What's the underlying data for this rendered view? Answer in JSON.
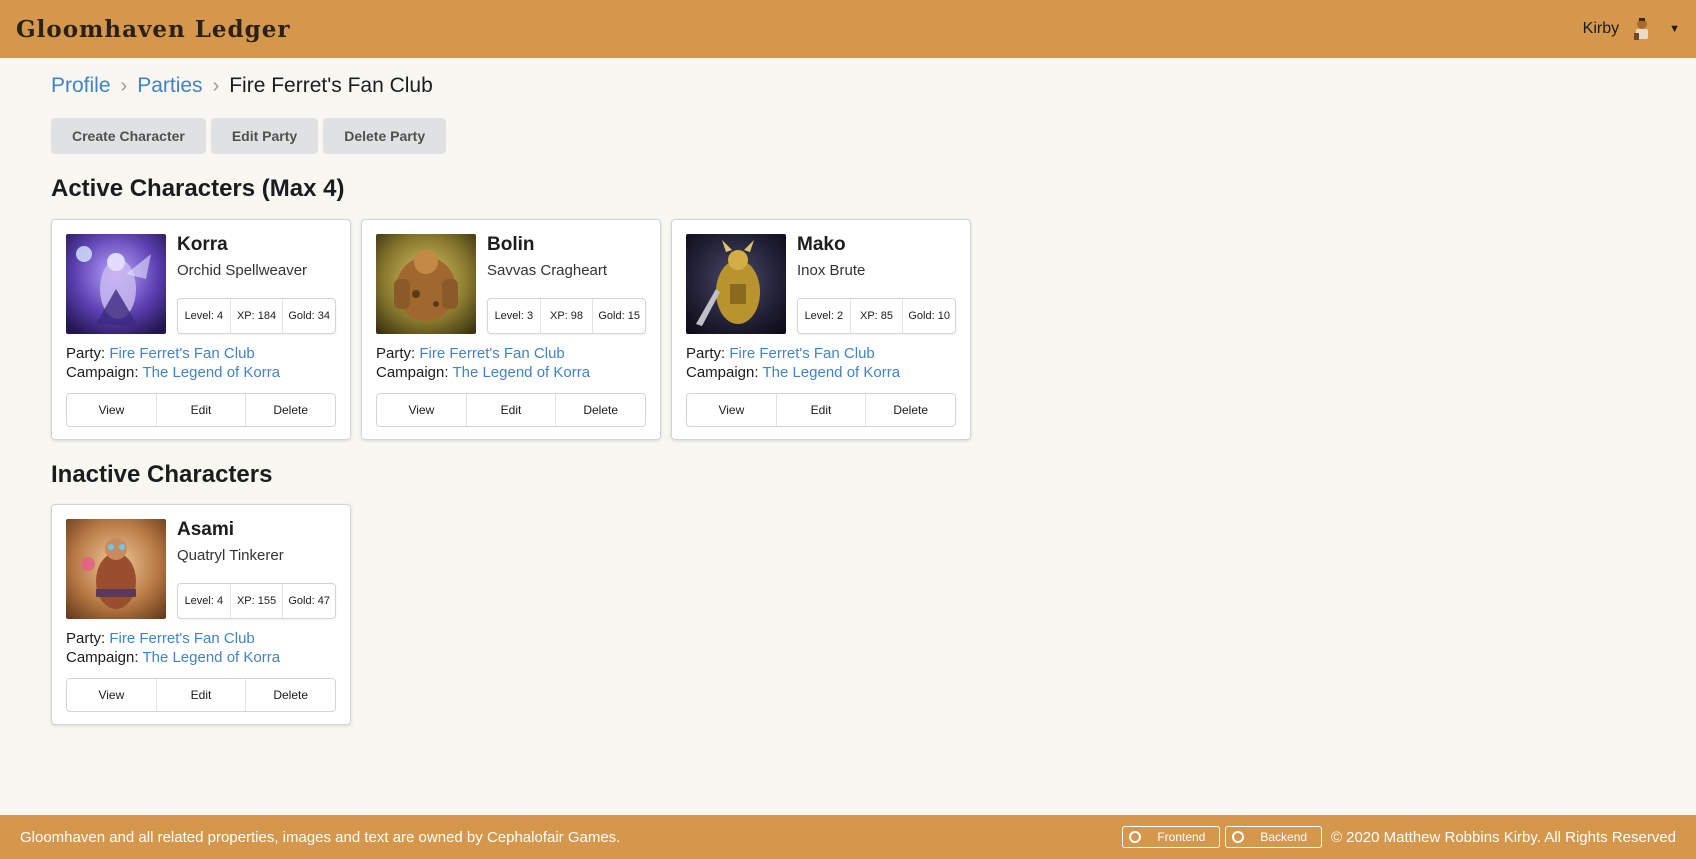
{
  "header": {
    "brand": "Gloomhaven Ledger",
    "user_name": "Kirby"
  },
  "breadcrumb": {
    "items": [
      "Profile",
      "Parties"
    ],
    "current": "Fire Ferret's Fan Club"
  },
  "actions": {
    "create_character": "Create Character",
    "edit_party": "Edit Party",
    "delete_party": "Delete Party"
  },
  "sections": {
    "active_title": "Active Characters (Max 4)",
    "inactive_title": "Inactive Characters"
  },
  "labels": {
    "party": "Party:",
    "campaign": "Campaign:",
    "view": "View",
    "edit": "Edit",
    "delete": "Delete"
  },
  "active_characters": [
    {
      "name": "Korra",
      "class": "Orchid Spellweaver",
      "level": "Level: 4",
      "xp": "XP: 184",
      "gold": "Gold: 34",
      "party": "Fire Ferret's Fan Club",
      "campaign": "The Legend of Korra"
    },
    {
      "name": "Bolin",
      "class": "Savvas Cragheart",
      "level": "Level: 3",
      "xp": "XP: 98",
      "gold": "Gold: 15",
      "party": "Fire Ferret's Fan Club",
      "campaign": "The Legend of Korra"
    },
    {
      "name": "Mako",
      "class": "Inox Brute",
      "level": "Level: 2",
      "xp": "XP: 85",
      "gold": "Gold: 10",
      "party": "Fire Ferret's Fan Club",
      "campaign": "The Legend of Korra"
    }
  ],
  "inactive_characters": [
    {
      "name": "Asami",
      "class": "Quatryl Tinkerer",
      "level": "Level: 4",
      "xp": "XP: 155",
      "gold": "Gold: 47",
      "party": "Fire Ferret's Fan Club",
      "campaign": "The Legend of Korra"
    }
  ],
  "footer": {
    "notice": "Gloomhaven and all related properties, images and text are owned by Cephalofair Games.",
    "frontend": "Frontend",
    "backend": "Backend",
    "copyright_symbol": "©",
    "copyright": "2020 Matthew Robbins Kirby. All Rights Reserved"
  },
  "colors": {
    "header": "#d4974b",
    "link": "#4183c4",
    "button": "#e0e1e2"
  }
}
